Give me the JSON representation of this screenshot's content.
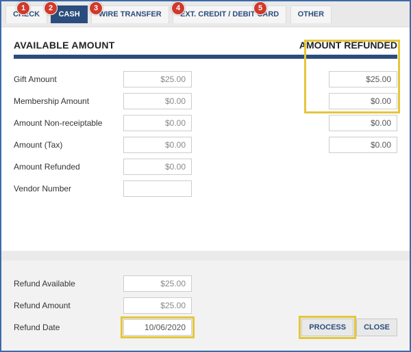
{
  "tabs": [
    {
      "label": "CHECK"
    },
    {
      "label": "CASH"
    },
    {
      "label": "WIRE TRANSFER"
    },
    {
      "label": "EXT. CREDIT / DEBIT CARD"
    },
    {
      "label": "OTHER"
    }
  ],
  "activeTab": 1,
  "badges": [
    "1",
    "2",
    "3",
    "4",
    "5"
  ],
  "headers": {
    "available": "AVAILABLE AMOUNT",
    "refunded": "AMOUNT REFUNDED"
  },
  "rows": {
    "gift": {
      "label": "Gift Amount",
      "available": "$25.00",
      "refunded": "$25.00"
    },
    "membership": {
      "label": "Membership Amount",
      "available": "$0.00",
      "refunded": "$0.00"
    },
    "nonreceiptable": {
      "label": "Amount Non-receiptable",
      "available": "$0.00",
      "refunded": "$0.00"
    },
    "tax": {
      "label": "Amount (Tax)",
      "available": "$0.00",
      "refunded": "$0.00"
    },
    "amount_refunded": {
      "label": "Amount Refunded",
      "available": "$0.00"
    },
    "vendor": {
      "label": "Vendor Number",
      "available": ""
    }
  },
  "lower": {
    "refund_available": {
      "label": "Refund Available",
      "value": "$25.00"
    },
    "refund_amount": {
      "label": "Refund Amount",
      "value": "$25.00"
    },
    "refund_date": {
      "label": "Refund Date",
      "value": "10/06/2020"
    }
  },
  "buttons": {
    "process": "PROCESS",
    "close": "CLOSE"
  }
}
